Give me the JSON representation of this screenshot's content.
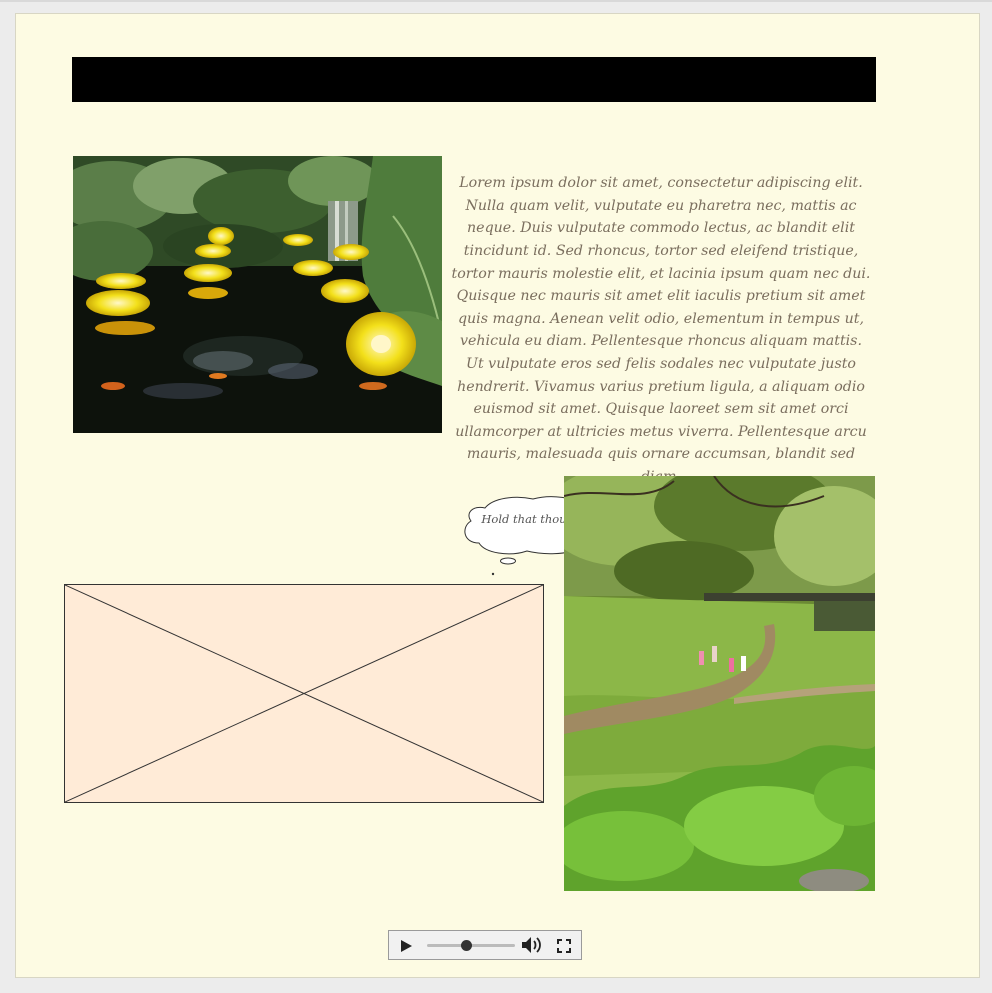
{
  "header": {
    "title": ""
  },
  "intro": {
    "paragraph": "Lorem ipsum dolor sit amet, consectetur adipiscing elit. Nulla quam velit, vulputate eu pharetra nec, mattis ac neque. Duis vulputate commodo lectus, ac blandit elit tincidunt id. Sed rhoncus, tortor sed eleifend tristique, tortor mauris molestie elit, et lacinia ipsum quam nec dui. Quisque nec mauris sit amet elit iaculis pretium sit amet quis magna. Aenean velit odio, elementum in tempus ut, vehicula eu diam. Pellentesque rhoncus aliquam mattis. Ut vulputate eros sed felis sodales nec vulputate justo hendrerit. Vivamus varius pretium ligula, a aliquam odio euismod sit amet. Quisque laoreet sem sit amet orci ullamcorper at ultricies metus viverra. Pellentesque arcu mauris, malesuada quis ornare accumsan, blandit sed diam."
  },
  "bubble": {
    "text": "Hold that thought!"
  },
  "media": {
    "progress": 0.45,
    "icons": [
      "play-icon",
      "volume-icon",
      "fullscreen-icon"
    ]
  },
  "colors": {
    "page_bg": "#fdfbe3",
    "header_bar": "#000000",
    "placeholder_bg": "#ffebd7",
    "text": "#7a6e5e"
  }
}
